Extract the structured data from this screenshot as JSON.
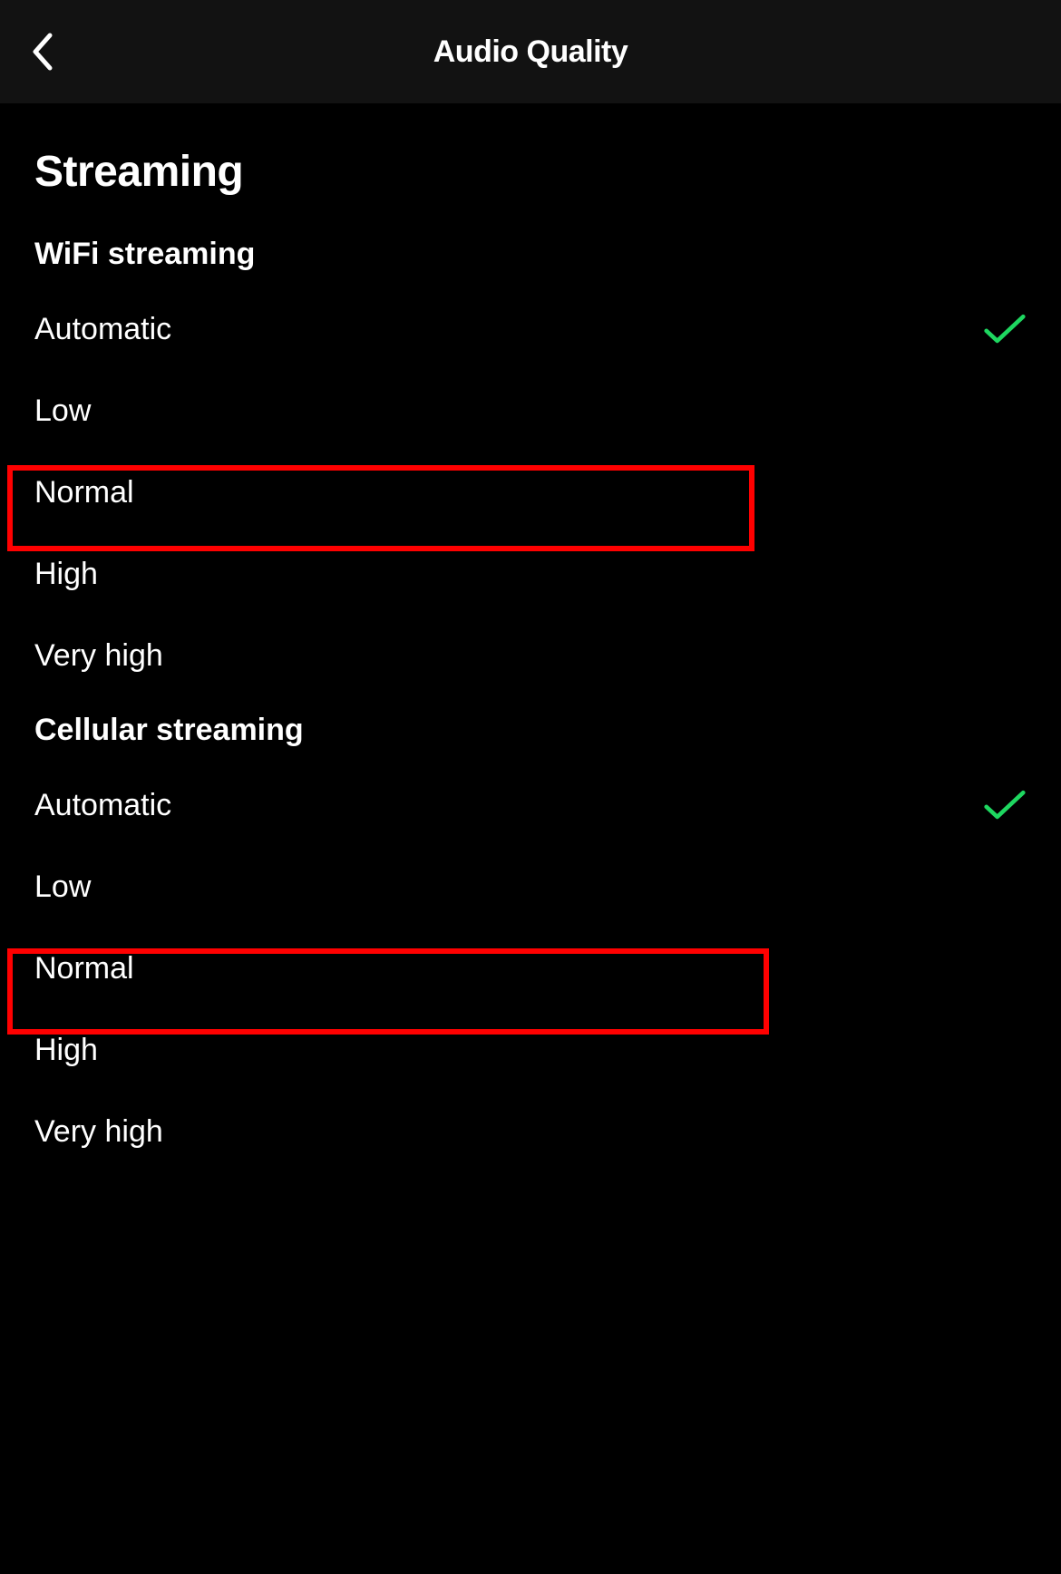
{
  "header": {
    "title": "Audio Quality"
  },
  "section": {
    "title": "Streaming"
  },
  "wifi": {
    "title": "WiFi streaming",
    "options": [
      {
        "label": "Automatic",
        "selected": true
      },
      {
        "label": "Low",
        "selected": false
      },
      {
        "label": "Normal",
        "selected": false
      },
      {
        "label": "High",
        "selected": false
      },
      {
        "label": "Very high",
        "selected": false
      }
    ]
  },
  "cellular": {
    "title": "Cellular streaming",
    "options": [
      {
        "label": "Automatic",
        "selected": true
      },
      {
        "label": "Low",
        "selected": false
      },
      {
        "label": "Normal",
        "selected": false
      },
      {
        "label": "High",
        "selected": false
      },
      {
        "label": "Very high",
        "selected": false
      }
    ]
  },
  "colors": {
    "check": "#1ed760"
  }
}
